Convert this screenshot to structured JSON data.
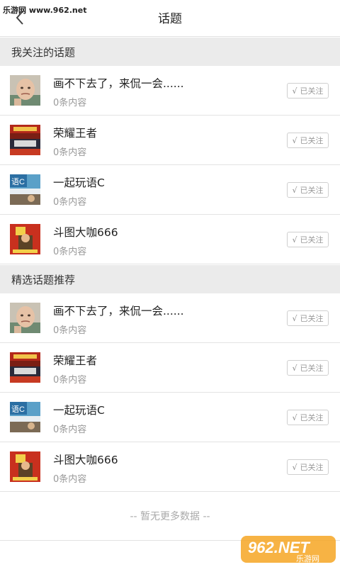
{
  "watermark": {
    "top_left": "乐游网 www.962.net",
    "logo_text": "962.NET",
    "logo_sub": "乐游网"
  },
  "header": {
    "title": "话题"
  },
  "sections": [
    {
      "title": "我关注的话题",
      "items": [
        {
          "title": "画不下去了，来侃一会......",
          "count": "0条内容",
          "follow": "已关注",
          "icon": "baby-avatar-icon"
        },
        {
          "title": "荣耀王者",
          "count": "0条内容",
          "follow": "已关注",
          "icon": "king-glory-poster-icon"
        },
        {
          "title": "一起玩语C",
          "count": "0条内容",
          "follow": "已关注",
          "icon": "yuc-poster-icon"
        },
        {
          "title": "斗图大咖666",
          "count": "0条内容",
          "follow": "已关注",
          "icon": "doutu-poster-icon"
        }
      ]
    },
    {
      "title": "精选话题推荐",
      "items": [
        {
          "title": "画不下去了，来侃一会......",
          "count": "0条内容",
          "follow": "已关注",
          "icon": "baby-avatar-icon"
        },
        {
          "title": "荣耀王者",
          "count": "0条内容",
          "follow": "已关注",
          "icon": "king-glory-poster-icon"
        },
        {
          "title": "一起玩语C",
          "count": "0条内容",
          "follow": "已关注",
          "icon": "yuc-poster-icon"
        },
        {
          "title": "斗图大咖666",
          "count": "0条内容",
          "follow": "已关注",
          "icon": "doutu-poster-icon"
        }
      ]
    }
  ],
  "footer": {
    "text": "-- 暂无更多数据 --"
  },
  "colors": {
    "section_bg": "#ebebeb",
    "border": "#e3e3e3",
    "muted": "#999999"
  }
}
